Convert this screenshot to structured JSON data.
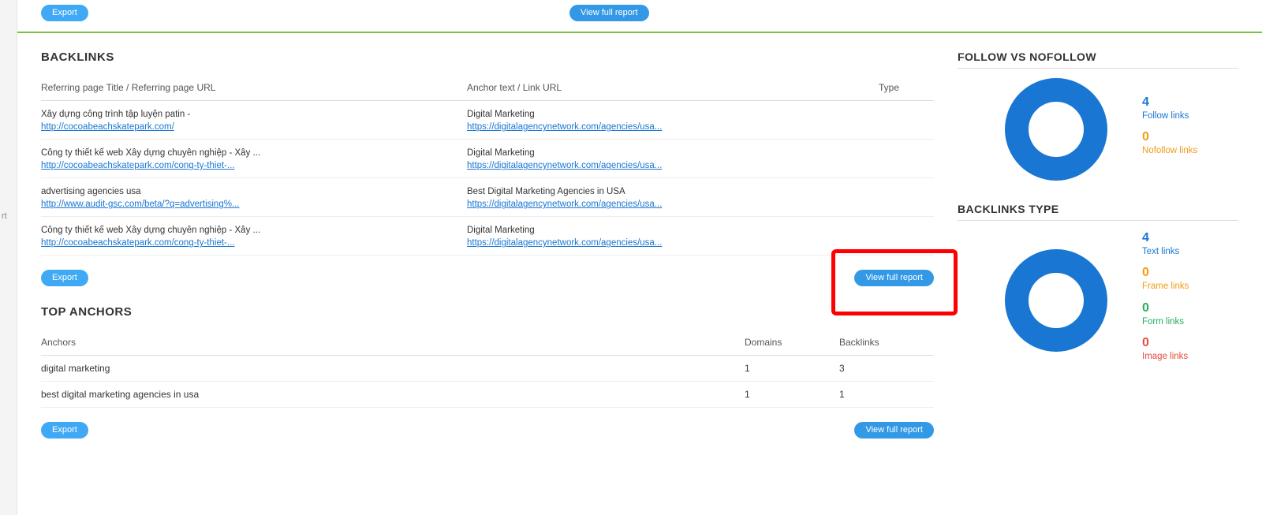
{
  "topbar": {
    "export_label": "Export",
    "view_full_report_label": "View full report"
  },
  "sidebar_stub_text": "rt",
  "backlinks": {
    "title": "BACKLINKS",
    "headers": {
      "ref": "Referring page Title / Referring page URL",
      "anchor": "Anchor text / Link URL",
      "type": "Type"
    },
    "rows": [
      {
        "ref_title": "Xây dựng công trình tập luyện patin -",
        "ref_url": "http://cocoabeachskatepark.com/",
        "anc_title": "Digital Marketing",
        "anc_url": "https://digitalagencynetwork.com/agencies/usa..."
      },
      {
        "ref_title": "Công ty thiết kế web Xây dựng chuyên nghiệp - Xây ...",
        "ref_url": "http://cocoabeachskatepark.com/cong-ty-thiet-...",
        "anc_title": "Digital Marketing",
        "anc_url": "https://digitalagencynetwork.com/agencies/usa..."
      },
      {
        "ref_title": "advertising agencies usa",
        "ref_url": "http://www.audit-gsc.com/beta/?q=advertising%...",
        "anc_title": "Best Digital Marketing Agencies in USA",
        "anc_url": "https://digitalagencynetwork.com/agencies/usa..."
      },
      {
        "ref_title": "Công ty thiết kế web Xây dựng chuyên nghiệp - Xây ...",
        "ref_url": "http://cocoabeachskatepark.com/cong-ty-thiet-...",
        "anc_title": "Digital Marketing",
        "anc_url": "https://digitalagencynetwork.com/agencies/usa..."
      }
    ],
    "export_label": "Export",
    "view_full_report_label": "View full report"
  },
  "anchors": {
    "title": "TOP ANCHORS",
    "headers": {
      "anchor": "Anchors",
      "domains": "Domains",
      "backlinks": "Backlinks"
    },
    "rows": [
      {
        "anchor": "digital marketing",
        "domains": "1",
        "backlinks": "3"
      },
      {
        "anchor": "best digital marketing agencies in usa",
        "domains": "1",
        "backlinks": "1"
      }
    ],
    "export_label": "Export",
    "view_full_report_label": "View full report"
  },
  "follow": {
    "title": "FOLLOW VS NOFOLLOW",
    "items": [
      {
        "value": "4",
        "label": "Follow links",
        "num_class": "num-blue",
        "lbl_class": ""
      },
      {
        "value": "0",
        "label": "Nofollow links",
        "num_class": "num-orange",
        "lbl_class": "orange"
      }
    ]
  },
  "bltype": {
    "title": "BACKLINKS TYPE",
    "items": [
      {
        "value": "4",
        "label": "Text links",
        "num_class": "num-blue",
        "lbl_class": ""
      },
      {
        "value": "0",
        "label": "Frame links",
        "num_class": "num-orange",
        "lbl_class": "orange"
      },
      {
        "value": "0",
        "label": "Form links",
        "num_class": "num-green",
        "lbl_class": "green"
      },
      {
        "value": "0",
        "label": "Image links",
        "num_class": "num-red",
        "lbl_class": "red"
      }
    ]
  },
  "chart_data": [
    {
      "type": "pie",
      "title": "FOLLOW VS NOFOLLOW",
      "categories": [
        "Follow links",
        "Nofollow links"
      ],
      "values": [
        4,
        0
      ],
      "colors": [
        "#1976d2",
        "#f39c12"
      ]
    },
    {
      "type": "pie",
      "title": "BACKLINKS TYPE",
      "categories": [
        "Text links",
        "Frame links",
        "Form links",
        "Image links"
      ],
      "values": [
        4,
        0,
        0,
        0
      ],
      "colors": [
        "#1976d2",
        "#f39c12",
        "#27ae60",
        "#e74c3c"
      ]
    }
  ]
}
